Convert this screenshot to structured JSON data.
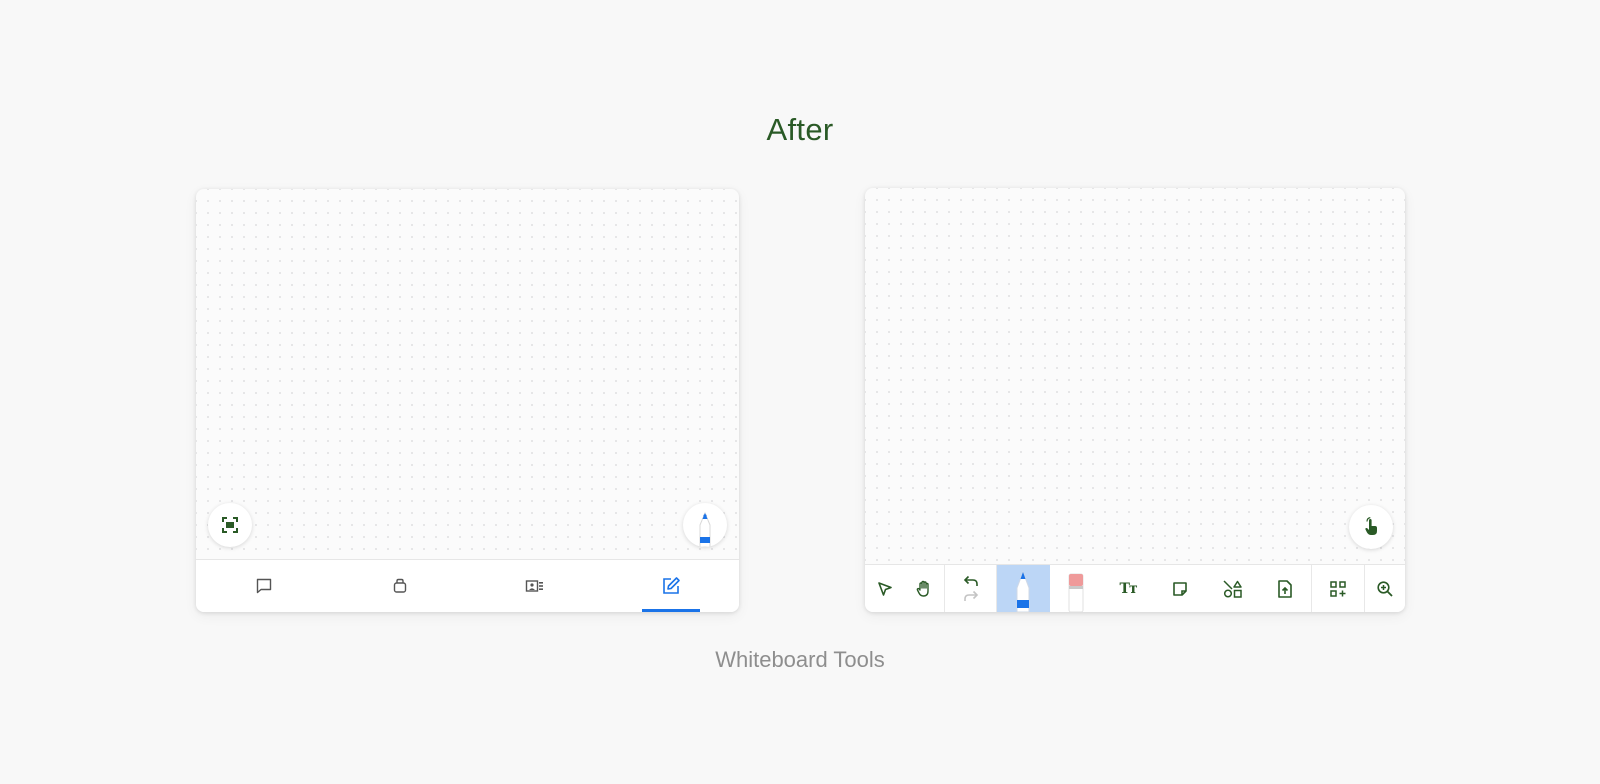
{
  "heading": "After",
  "caption": "Whiteboard Tools",
  "colors": {
    "accent_green": "#2a5a26",
    "active_blue": "#1a73e8",
    "active_tool_bg": "#bcd6f6",
    "caption_gray": "#8e8e8e"
  },
  "left_panel": {
    "fabs": [
      {
        "name": "fit-to-screen-icon"
      },
      {
        "name": "marker-pen-icon"
      }
    ],
    "tabs": [
      {
        "name": "chat-icon",
        "active": false
      },
      {
        "name": "bag-icon",
        "active": false
      },
      {
        "name": "contact-card-icon",
        "active": false
      },
      {
        "name": "edit-icon",
        "active": true
      }
    ]
  },
  "right_panel": {
    "fab": {
      "name": "touch-hand-icon"
    },
    "tools": [
      {
        "name": "select-arrow-icon"
      },
      {
        "name": "hand-pan-icon"
      },
      {
        "name": "undo-icon"
      },
      {
        "name": "redo-icon"
      },
      {
        "name": "pen-icon",
        "active": true
      },
      {
        "name": "eraser-icon"
      },
      {
        "name": "text-icon",
        "glyph": "Tт"
      },
      {
        "name": "sticky-note-icon"
      },
      {
        "name": "shapes-icon"
      },
      {
        "name": "upload-file-icon"
      },
      {
        "name": "add-widget-icon"
      },
      {
        "name": "zoom-in-icon"
      }
    ]
  }
}
